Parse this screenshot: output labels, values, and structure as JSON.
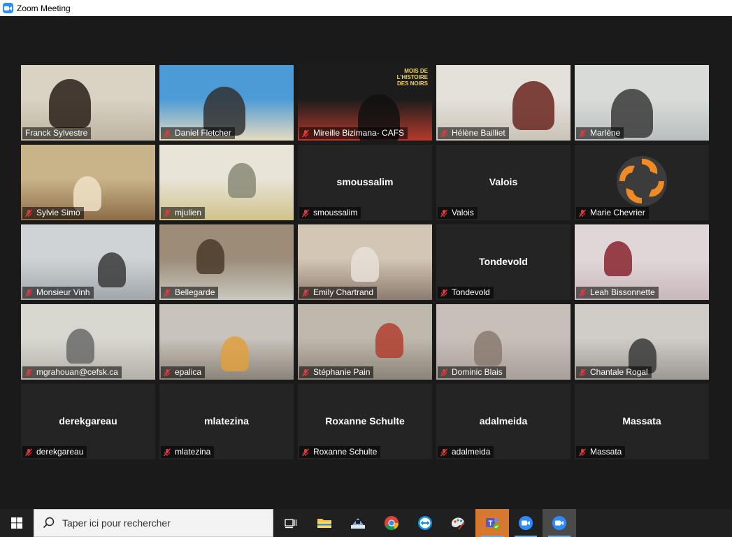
{
  "window": {
    "title": "Zoom Meeting"
  },
  "participants": [
    {
      "name": "Franck Sylvestre",
      "muted": false,
      "video": true,
      "active": true
    },
    {
      "name": "Daniel Fletcher",
      "muted": true,
      "video": true
    },
    {
      "name": "Mireille Bizimana- CAFS",
      "muted": true,
      "video": true,
      "background_text": "MOIS DE L'HISTOIRE DES NOIRS"
    },
    {
      "name": "Hélène Bailliet",
      "muted": true,
      "video": true
    },
    {
      "name": "Marlène",
      "muted": true,
      "video": true
    },
    {
      "name": "Sylvie Simo",
      "muted": true,
      "video": true
    },
    {
      "name": "mjulien",
      "muted": true,
      "video": true
    },
    {
      "name": "smoussalim",
      "muted": true,
      "video": false
    },
    {
      "name": "Valois",
      "muted": true,
      "video": false
    },
    {
      "name": "Marie Chevrier",
      "muted": true,
      "video": false,
      "logo": true
    },
    {
      "name": "Monsieur Vinh",
      "muted": true,
      "video": true
    },
    {
      "name": "Bellegarde",
      "muted": true,
      "video": true
    },
    {
      "name": "Emily Chartrand",
      "muted": true,
      "video": true
    },
    {
      "name": "Tondevold",
      "muted": true,
      "video": false
    },
    {
      "name": "Leah Bissonnette",
      "muted": true,
      "video": true
    },
    {
      "name": "mgrahouan@cefsk.ca",
      "muted": true,
      "video": true
    },
    {
      "name": "epalica",
      "muted": true,
      "video": true
    },
    {
      "name": "Stéphanie Pain",
      "muted": true,
      "video": true
    },
    {
      "name": "Dominic Blais",
      "muted": true,
      "video": true
    },
    {
      "name": "Chantale Rogal",
      "muted": true,
      "video": true
    },
    {
      "name": "derekgareau",
      "muted": true,
      "video": false
    },
    {
      "name": "mlatezina",
      "muted": true,
      "video": false
    },
    {
      "name": "Roxanne Schulte",
      "muted": true,
      "video": false
    },
    {
      "name": "adalmeida",
      "muted": true,
      "video": false
    },
    {
      "name": "Massata",
      "muted": true,
      "video": false
    }
  ],
  "taskbar": {
    "search_placeholder": "Taper ici pour rechercher",
    "icons": [
      "windows-start-icon",
      "task-view-icon",
      "file-explorer-icon",
      "scanner-icon",
      "chrome-icon",
      "teamviewer-icon",
      "paint-icon",
      "teams-icon",
      "zoom-icon",
      "zoom-meeting-icon"
    ]
  },
  "colors": {
    "active_border": "#c9e27a",
    "muted_icon": "#e0393e",
    "zoom_blue": "#2d8cff",
    "tile_bg": "#242424"
  }
}
